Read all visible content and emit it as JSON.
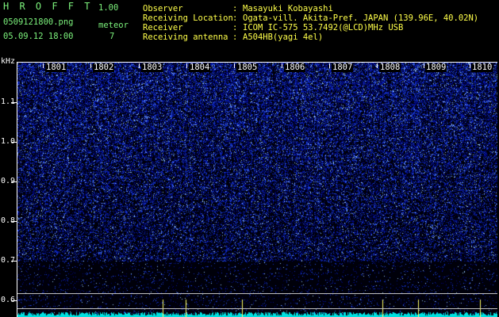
{
  "app": {
    "name": "H R O F F T",
    "version": "1.00",
    "filename": "0509121800.png",
    "datetime": "05.09.12 18:00",
    "meteor_label": "meteor",
    "meteor_count": "7"
  },
  "info": [
    {
      "label": "Observer",
      "sep": ":",
      "value": "Masayuki Kobayashi"
    },
    {
      "label": "Receiving Location",
      "sep": ":",
      "value": "Ogata-vill. Akita-Pref. JAPAN (139.96E, 40.02N)"
    },
    {
      "label": "Receiver",
      "sep": ":",
      "value": "ICOM IC-575 53.7492(@LCD)MHz USB"
    },
    {
      "label": "Receiving antenna",
      "sep": ":",
      "value": "A504HB(yagi 4el)"
    }
  ],
  "axis": {
    "unit": "kHz",
    "y_labels": [
      "1.1",
      "1.0",
      "0.9",
      "0.8",
      "0.7",
      "0.6"
    ],
    "minute_labels": [
      "1801",
      "1802",
      "1803",
      "1804",
      "1805",
      "1806",
      "1807",
      "1808",
      "1809",
      "1810"
    ]
  },
  "colors": {
    "background": "#000000",
    "spectro_dark": "#000010",
    "spectro_bright": "#3050ff",
    "noise_trace": "#00ffff",
    "header_green": "#7cf27c",
    "header_yellow": "#ffff4a"
  }
}
